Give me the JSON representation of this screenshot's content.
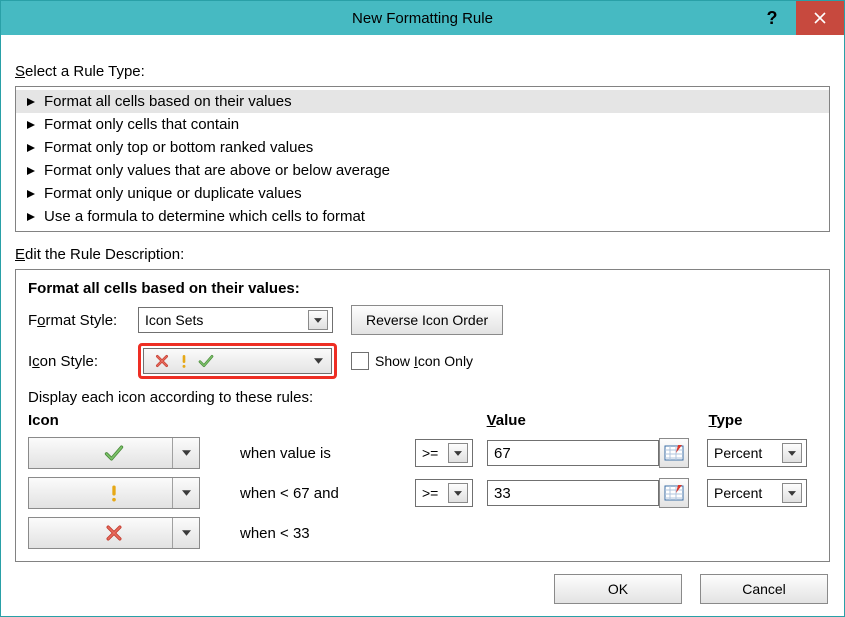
{
  "window": {
    "title": "New Formatting Rule"
  },
  "labels": {
    "selectRuleType_pre": "S",
    "selectRuleType_rest": "elect a Rule Type:",
    "editDesc_pre": "E",
    "editDesc_rest": "dit the Rule Description:",
    "formatStyle": "Format Style:",
    "formatStyle_pre": "F",
    "formatStyle_u": "o",
    "formatStyle_rest": "rmat Style:",
    "iconStyle_pre": "I",
    "iconStyle_u": "c",
    "iconStyle_rest": "on Style:",
    "reverseOrder": "Reverse Icon Order",
    "showIconOnly_pre": "Show ",
    "showIconOnly_u": "I",
    "showIconOnly_rest": "con Only",
    "displayRules": "Display each icon according to these rules:",
    "colIcon": "Icon",
    "colValue_u": "V",
    "colValue_rest": "alue",
    "colType_u": "T",
    "colType_rest": "ype"
  },
  "descHeader": "Format all cells based on their values:",
  "ruleTypes": [
    "Format all cells based on their values",
    "Format only cells that contain",
    "Format only top or bottom ranked values",
    "Format only values that are above or below average",
    "Format only unique or duplicate values",
    "Use a formula to determine which cells to format"
  ],
  "formatStyleValue": "Icon Sets",
  "rules": [
    {
      "icon": "check",
      "condition": "when value is",
      "op": ">=",
      "value": "67",
      "type": "Percent"
    },
    {
      "icon": "bang",
      "condition": "when < 67 and",
      "op": ">=",
      "value": "33",
      "type": "Percent"
    },
    {
      "icon": "cross",
      "condition": "when < 33",
      "op": "",
      "value": "",
      "type": ""
    }
  ],
  "buttons": {
    "ok": "OK",
    "cancel": "Cancel"
  }
}
